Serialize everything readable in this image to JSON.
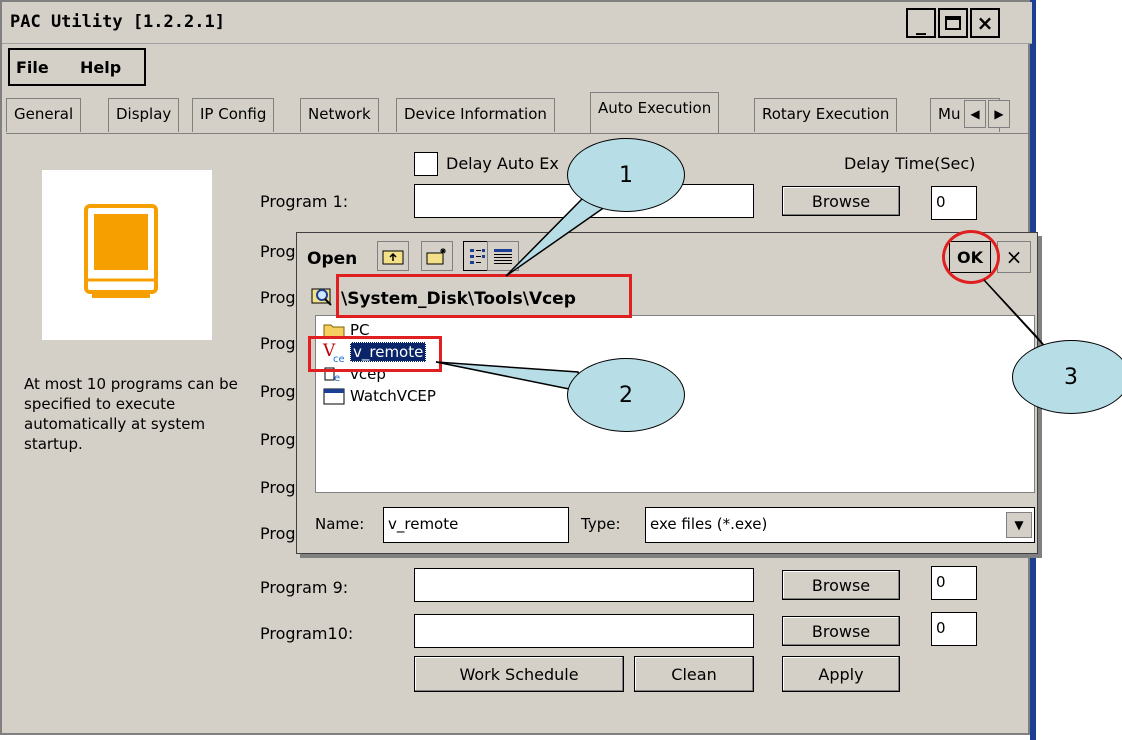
{
  "window": {
    "title": "PAC Utility  [1.2.2.1]",
    "minimize": "_",
    "maximize": "□",
    "close": "×"
  },
  "menu": {
    "file": "File",
    "help": "Help"
  },
  "tabs": [
    {
      "label": "General"
    },
    {
      "label": "Display"
    },
    {
      "label": "IP Config"
    },
    {
      "label": "Network"
    },
    {
      "label": "Device Information"
    },
    {
      "label": "Auto Execution"
    },
    {
      "label": "Rotary Execution"
    },
    {
      "label": "Mu"
    }
  ],
  "tab_scroll": {
    "left": "◀",
    "right": "▶"
  },
  "auto_exec": {
    "delay_checkbox_label": "Delay Auto Ex",
    "delay_time_header": "Delay Time(Sec)",
    "description": "At most 10 programs can be specified to execute automatically at system startup.",
    "program1_label": "Program 1:",
    "prog_partial": "Prog",
    "program9_label": "Program 9:",
    "program10_label": "Program10:",
    "browse_label": "Browse",
    "delay_value": "0",
    "work_schedule": "Work Schedule",
    "clean": "Clean",
    "apply": "Apply"
  },
  "open_dialog": {
    "title": "Open",
    "ok": "OK",
    "close": "×",
    "path": "\\System_Disk\\Tools\\Vcep",
    "files": [
      {
        "name": "PC",
        "icon": "folder-icon"
      },
      {
        "name": "v_remote",
        "icon": "vce-icon"
      },
      {
        "name": "vcep",
        "icon": "exe-icon"
      },
      {
        "name": "WatchVCEP",
        "icon": "window-icon"
      }
    ],
    "name_label": "Name:",
    "name_value": "v_remote",
    "type_label": "Type:",
    "type_value": "exe files (*.exe)"
  },
  "callouts": {
    "c1": "1",
    "c2": "2",
    "c3": "3"
  },
  "colors": {
    "annotation_red": "#e02020",
    "callout_fill": "#b7dde6",
    "monitor_orange": "#f5a000"
  }
}
